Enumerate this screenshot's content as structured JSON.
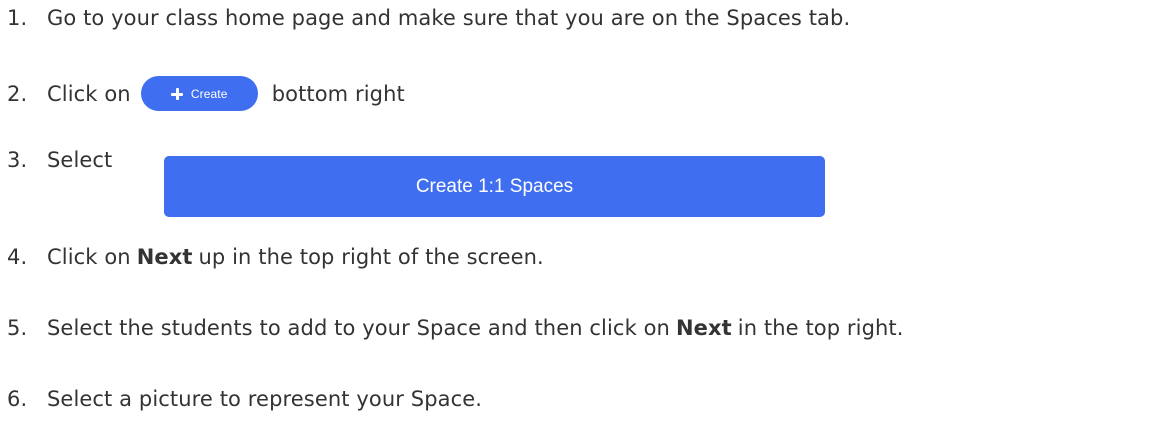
{
  "steps": [
    {
      "number": "1.",
      "text": "Go to your class home page and make sure that you are on the  Spaces tab."
    },
    {
      "number": "2.",
      "before": "Click on",
      "button_label": "Create",
      "after": "bottom right"
    },
    {
      "number": "3.",
      "before": "Select",
      "button_label": "Create 1:1 Spaces"
    },
    {
      "number": "4.",
      "before": "Click on",
      "bold": "Next",
      "after": "up in the top right of the screen."
    },
    {
      "number": "5.",
      "before": "Select the students to add to your Space and then click on",
      "bold": "Next",
      "after": "in the top right."
    },
    {
      "number": "6.",
      "text": "Select a picture to represent your Space."
    }
  ],
  "colors": {
    "button_blue": "#3f6ef0",
    "text": "#333333"
  },
  "icons": {
    "create_button": "plus-icon"
  }
}
